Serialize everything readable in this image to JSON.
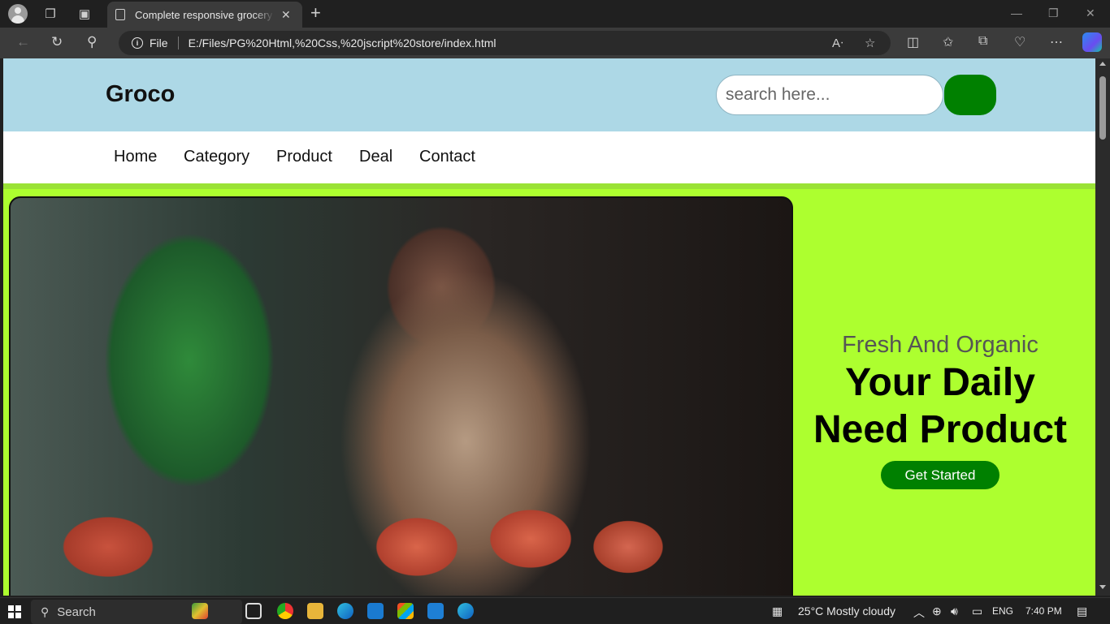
{
  "browser": {
    "tab_title": "Complete responsive grocery website",
    "tab_close": "✕",
    "new_tab": "+",
    "address_prefix": "File",
    "url": "E:/Files/PG%20Html,%20Css,%20jscript%20store/index.html"
  },
  "site": {
    "logo": "Groco",
    "search_placeholder": "search here...",
    "nav": [
      "Home",
      "Category",
      "Product",
      "Deal",
      "Contact"
    ],
    "hero": {
      "subtitle": "Fresh And Organic",
      "title_line1": "Your Daily",
      "title_line2": "Need Product",
      "cta": "Get Started"
    }
  },
  "taskbar": {
    "search_label": "Search",
    "weather": "25°C  Mostly cloudy",
    "language": "ENG",
    "time": "7:40 PM"
  },
  "colors": {
    "header_bg": "#add8e6",
    "accent_green": "#008000",
    "hero_bg": "#adff2f"
  }
}
